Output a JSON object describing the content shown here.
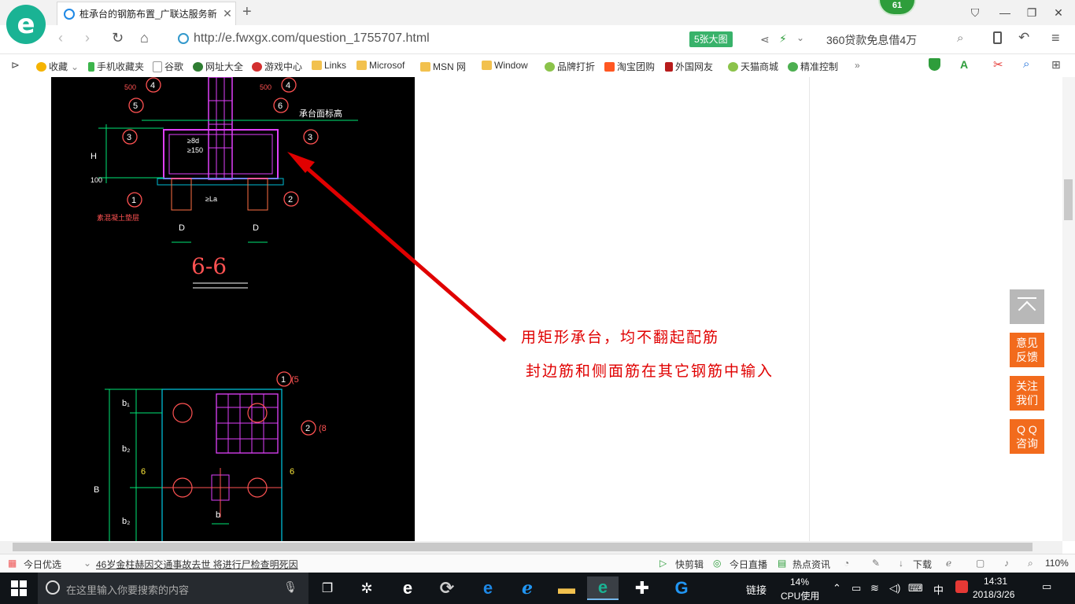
{
  "browser": {
    "tab_title": "桩承台的钢筋布置_广联达服务新",
    "notify_count": "61",
    "url": "http://e.fwxgx.com/question_1755707.html",
    "big_pic_label": "5张大图",
    "ad_text": "360贷款免息借4万"
  },
  "bookmarks": [
    {
      "label": "收藏",
      "color": "#f5b300"
    },
    {
      "label": "手机收藏夹",
      "color": "#3cb44b"
    },
    {
      "label": "谷歌",
      "color": "#9e9e9e"
    },
    {
      "label": "网址大全",
      "color": "#2e7d32"
    },
    {
      "label": "游戏中心",
      "color": "#d32f2f"
    },
    {
      "label": "Links",
      "color": "#f2c14e"
    },
    {
      "label": "Microsof",
      "color": "#f2c14e"
    },
    {
      "label": "MSN 网",
      "color": "#f2c14e"
    },
    {
      "label": "Window",
      "color": "#f2c14e"
    },
    {
      "label": "品牌打折",
      "color": "#8bc34a"
    },
    {
      "label": "淘宝团购",
      "color": "#ff5722"
    },
    {
      "label": "外国网友",
      "color": "#b71c1c"
    },
    {
      "label": "天猫商城",
      "color": "#8bc34a"
    },
    {
      "label": "精准控制",
      "color": "#4caf50"
    }
  ],
  "drawing": {
    "section_title": "6-6",
    "labels": {
      "n500a": "500",
      "n500b": "500",
      "c1": "1",
      "c2": "2",
      "c3a": "3",
      "c3b": "3",
      "c4a": "4",
      "c4b": "4",
      "c5": "5",
      "c6": "6",
      "cap_top": "承台面标高",
      "h": "H",
      "h100": "100",
      "d1": "D",
      "d2": "D",
      "la": "≥La",
      "d8": "≥8d",
      "d150": "≥150",
      "cushion": "素混凝土垫层",
      "b1": "b₁",
      "b2a": "b₂",
      "b2b": "b₂",
      "bB": "B",
      "b_small": "b",
      "s6a": "6",
      "s6b": "6",
      "c15": "1",
      "c15b": "(5",
      "c28": "2",
      "c28b": "(8"
    }
  },
  "annotation": {
    "line1": "用矩形承台，均不翻起配筋",
    "line2": "封边筋和侧面筋在其它钢筋中输入"
  },
  "side_buttons": {
    "feedback_1": "意见",
    "feedback_2": "反馈",
    "follow_1": "关注",
    "follow_2": "我们",
    "qq_1": "Q Q",
    "qq_2": "咨询"
  },
  "statusbar": {
    "today": "今日优选",
    "news": "46岁金柱赫因交通事故去世 将进行尸检查明死因",
    "clip": "快剪辑",
    "live": "今日直播",
    "hot": "热点资讯",
    "download": "下载",
    "zoom": "110%"
  },
  "taskbar": {
    "search_placeholder": "在这里输入你要搜索的内容",
    "link_label": "链接",
    "cpu_pct": "14%",
    "cpu_label": "CPU使用",
    "ime": "中",
    "time": "14:31",
    "date": "2018/3/26"
  }
}
